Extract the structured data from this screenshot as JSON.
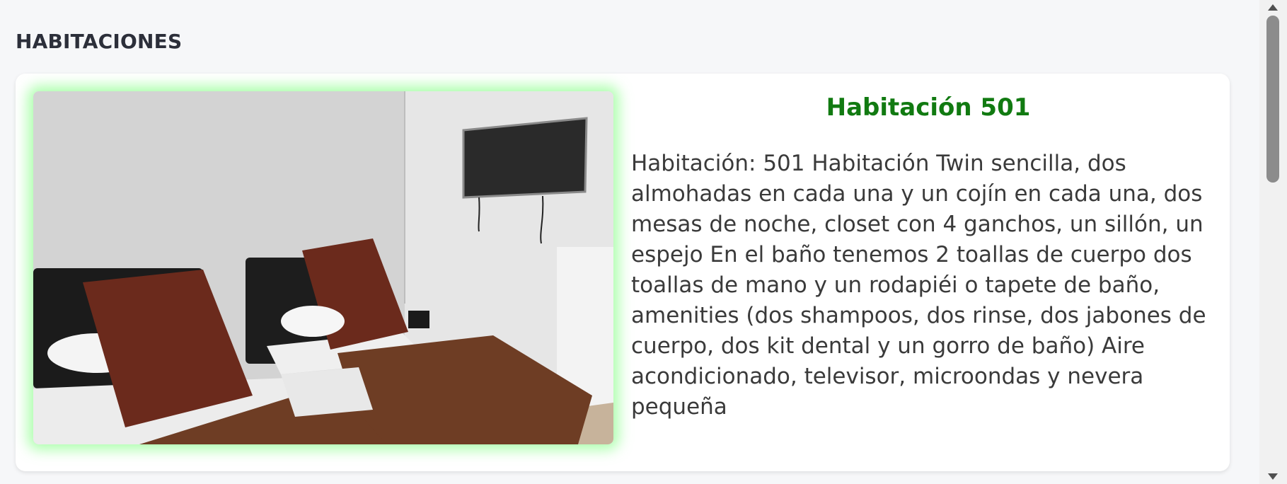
{
  "section": {
    "title": "HABITACIONES"
  },
  "room": {
    "title": "Habitación 501",
    "description": "Habitación: 501 Habitación Twin sencilla, dos almohadas en cada una y un cojín en cada una, dos mesas de noche, closet con 4 ganchos, un sillón, un espejo En el baño tenemos 2 toallas de cuerpo dos toallas de mano y un rodapiéi o tapete de baño, amenities (dos shampoos, dos rinse, dos jabones de cuerpo, dos kit dental y un gorro de baño) Aire acondicionado, televisor, microondas y nevera pequeña",
    "photo_icon": "twin-bedroom-photo"
  },
  "colors": {
    "title_green": "#117a11",
    "glow_green": "#6eff6e",
    "text": "#3a3a3a",
    "heading": "#2c2f3a"
  }
}
